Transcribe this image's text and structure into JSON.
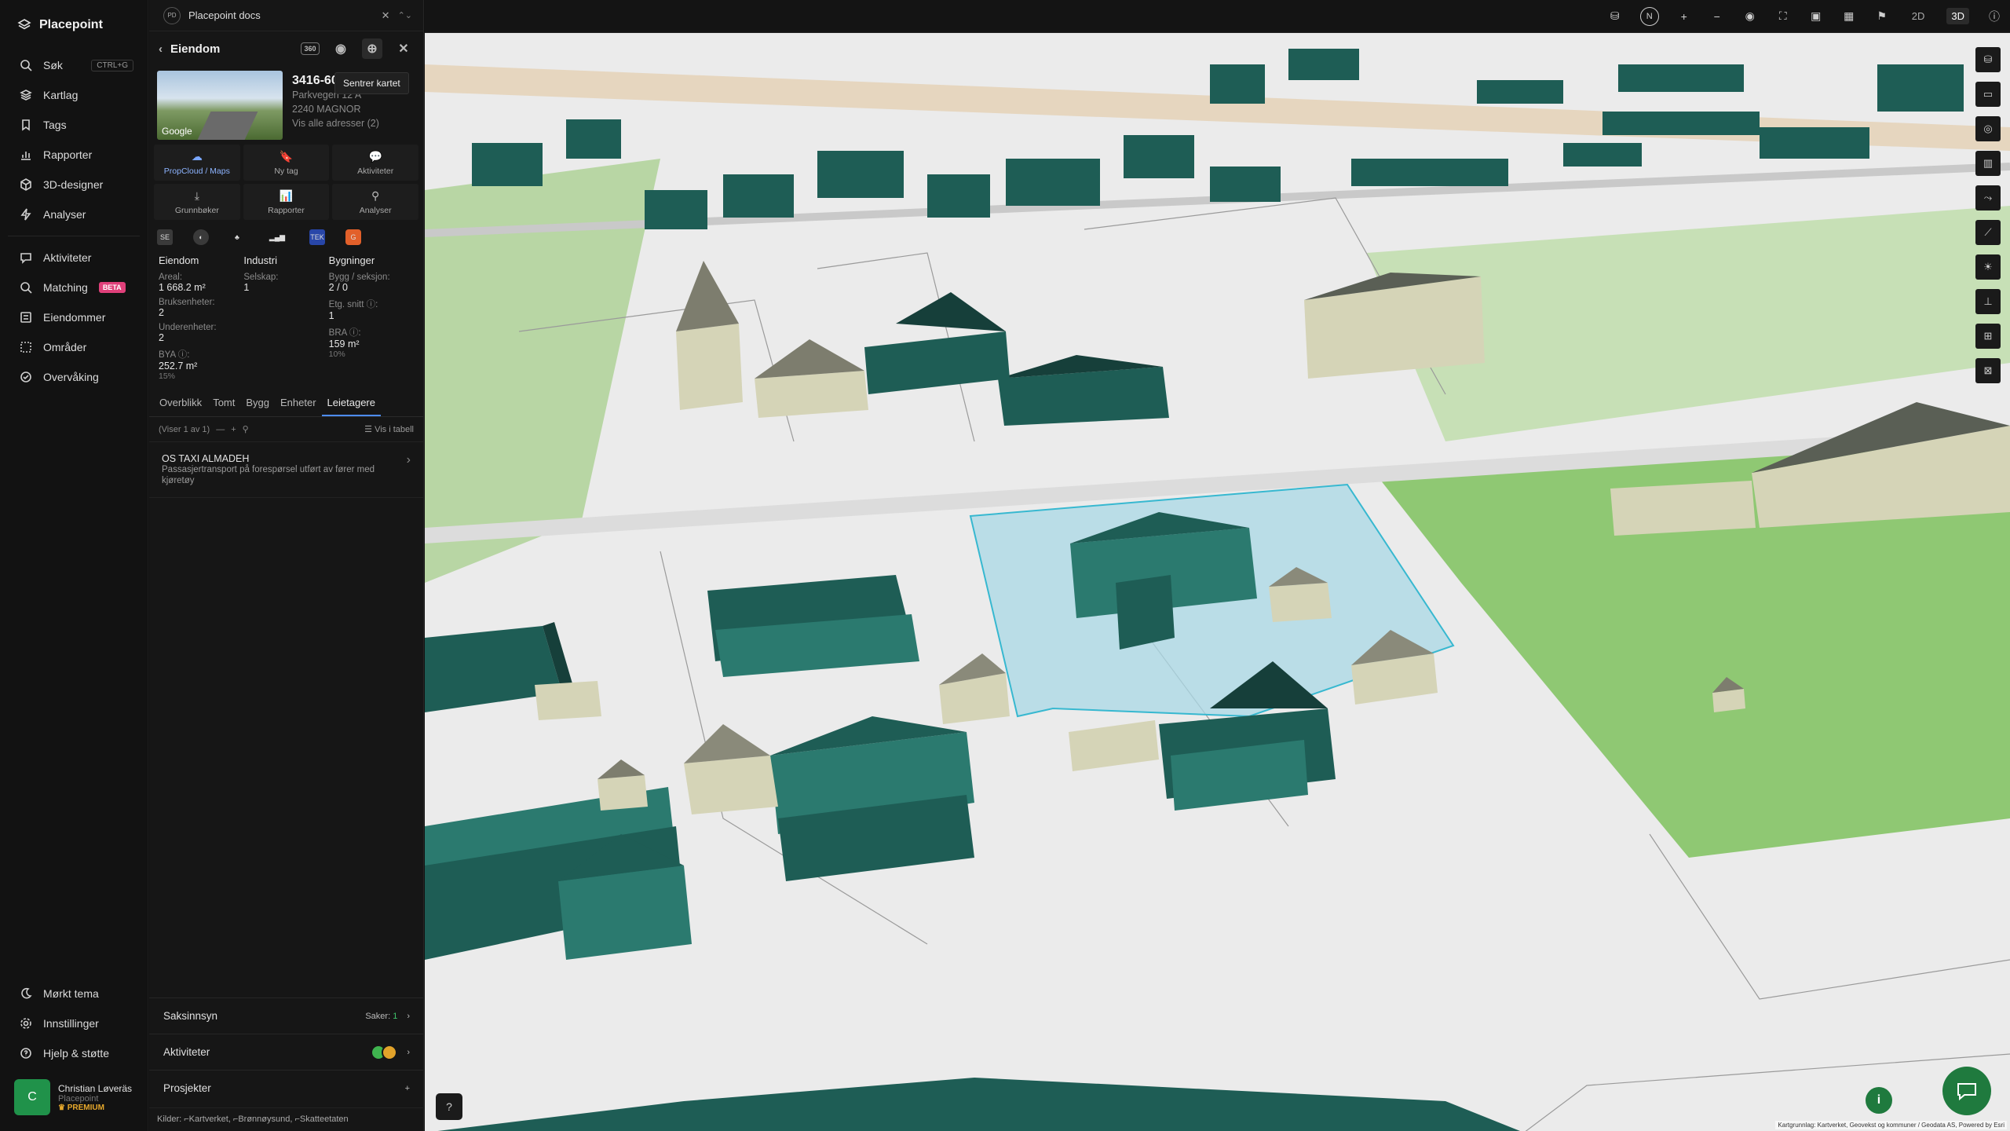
{
  "nav": {
    "brand": "Placepoint",
    "items": [
      {
        "label": "Søk",
        "shortcut": "CTRL+G"
      },
      {
        "label": "Kartlag"
      },
      {
        "label": "Tags"
      },
      {
        "label": "Rapporter"
      },
      {
        "label": "3D-designer"
      },
      {
        "label": "Analyser"
      }
    ],
    "items2": [
      {
        "label": "Aktiviteter"
      },
      {
        "label": "Matching",
        "badge": "BETA"
      },
      {
        "label": "Eiendommer"
      },
      {
        "label": "Områder"
      },
      {
        "label": "Overvåking"
      }
    ],
    "bottom": [
      {
        "label": "Mørkt tema"
      },
      {
        "label": "Innstillinger"
      },
      {
        "label": "Hjelp & støtte"
      }
    ],
    "user": {
      "initial": "C",
      "name": "Christian Løveräs",
      "org": "Placepoint",
      "plan": "PREMIUM"
    }
  },
  "panel": {
    "top_badge": "PD",
    "top_title": "Placepoint docs",
    "header": "Eiendom",
    "tooltip": "Sentrer kartet",
    "property": {
      "id": "3416-60",
      "address": "Parkvegen 12 A",
      "postal": "2240 MAGNOR",
      "all_addresses": "Vis alle adresser (2)",
      "photo_label": "Google"
    },
    "actions": [
      {
        "label": "PropCloud / Maps",
        "icon": "☁"
      },
      {
        "label": "Ny tag",
        "icon": "🔖"
      },
      {
        "label": "Aktiviteter",
        "icon": "💬"
      },
      {
        "label": "Grunnbøker",
        "icon": "⤓"
      },
      {
        "label": "Rapporter",
        "icon": "📊"
      },
      {
        "label": "Analyser",
        "icon": "⚲"
      }
    ],
    "logos": [
      "SE",
      "◐",
      "♣",
      "▂▄▆",
      "TEK",
      "G"
    ],
    "eiendom": {
      "title": "Eiendom",
      "areal_label": "Areal:",
      "areal": "1 668.2 m²",
      "bruks_label": "Bruksenheter:",
      "bruks": "2",
      "under_label": "Underenheter:",
      "under": "2",
      "bya_label": "BYA ⓘ:",
      "bya": "252.7 m²",
      "bya_pct": "15%"
    },
    "industri": {
      "title": "Industri",
      "selskap_label": "Selskap:",
      "selskap": "1"
    },
    "bygninger": {
      "title": "Bygninger",
      "bygg_label": "Bygg / seksjon:",
      "bygg": "2 / 0",
      "etg_label": "Etg. snitt ⓘ:",
      "etg": "1",
      "bra_label": "BRA ⓘ:",
      "bra": "159 m²",
      "bra_pct": "10%"
    },
    "tabs": [
      "Overblikk",
      "Tomt",
      "Bygg",
      "Enheter",
      "Leietagere"
    ],
    "active_tab": "Leietagere",
    "list_count": "(Viser 1 av 1)",
    "list_table": "Vis i tabell",
    "tenant": {
      "name": "OS TAXI ALMADEH",
      "desc": "Passasjertransport på forespørsel utført av fører med kjøretøy"
    },
    "accordions": {
      "saksinnsyn": "Saksinnsyn",
      "saker_label": "Saker:",
      "saker_count": "1",
      "aktiviteter": "Aktiviteter",
      "prosjekter": "Prosjekter"
    },
    "sources": "Kilder: ⌐Kartverket, ⌐Brønnøysund, ⌐Skatteetaten"
  },
  "topbar": {
    "compass": "N",
    "view_2d": "2D",
    "view_3d": "3D"
  },
  "map": {
    "attribution": "Kartgrunnlag: Kartverket, Geovekst og kommuner / Geodata AS, Powered by Esri"
  },
  "colors": {
    "building_roof": "#1e5d55",
    "building_wall": "#2b7a6f",
    "grass": "#8fc873",
    "selection": "#a9d8e6",
    "accent": "#4d8dff"
  }
}
